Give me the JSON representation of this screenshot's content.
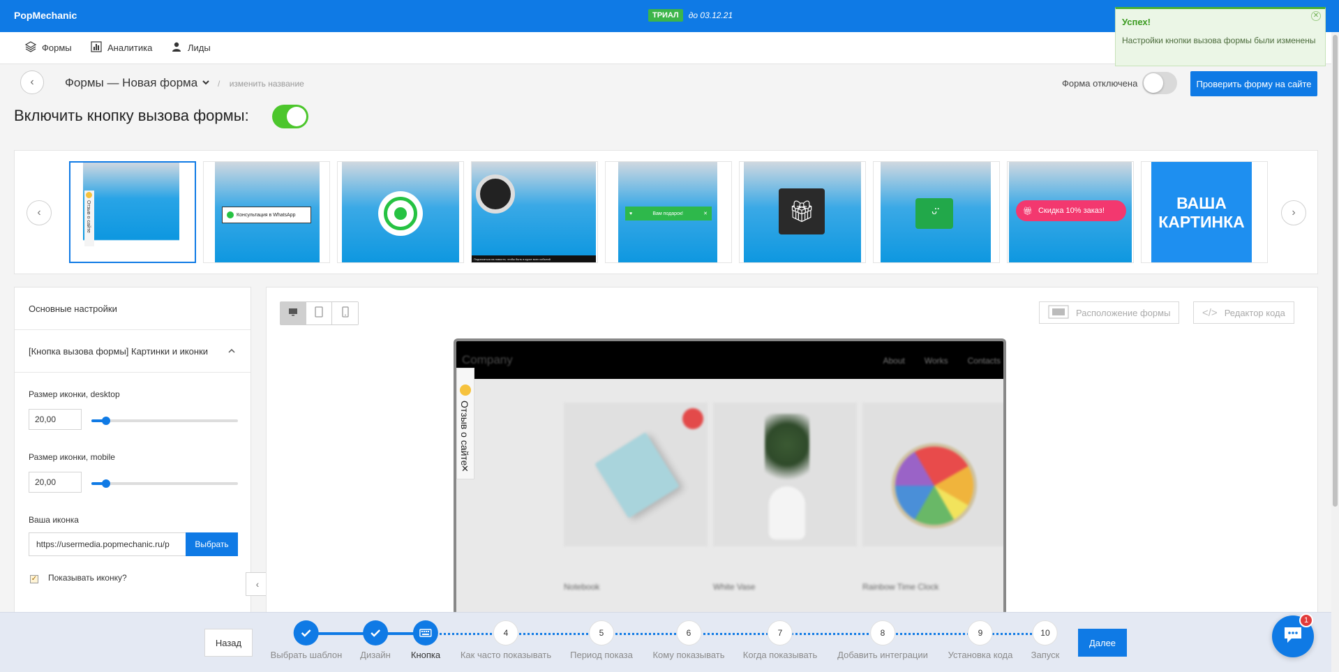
{
  "app": {
    "brand": "PopMechanic",
    "trial_badge": "ТРИАЛ",
    "trial_until": "до 03.12.21"
  },
  "nav": {
    "items": [
      {
        "label": "Формы",
        "icon": "layers-icon"
      },
      {
        "label": "Аналитика",
        "icon": "bar-chart-icon"
      },
      {
        "label": "Лиды",
        "icon": "user-icon"
      }
    ]
  },
  "header": {
    "form_title": "Формы — Новая форма",
    "rename_link": "изменить название",
    "separator": "/",
    "status_label": "Форма отключена",
    "status_enabled": false,
    "check_button": "Проверить форму на сайте"
  },
  "call_button": {
    "title": "Включить кнопку вызова формы:",
    "enabled": true
  },
  "templates": {
    "selected_index": 0,
    "items": [
      {
        "name": "side-tab-review",
        "caption": "Отзыв о сайте"
      },
      {
        "name": "whatsapp-consult",
        "caption": "Консультация в WhatsApp"
      },
      {
        "name": "whatsapp-icon",
        "caption": ""
      },
      {
        "name": "camera-banner",
        "caption": "Подписаться на новости, чтобы быть в курсе всех событий"
      },
      {
        "name": "gift-bar",
        "caption": "Вам подарок!"
      },
      {
        "name": "gift-icon",
        "caption": ""
      },
      {
        "name": "chat-smile-icon",
        "caption": ""
      },
      {
        "name": "discount-pill",
        "caption": "Скидка 10% заказ!"
      },
      {
        "name": "your-picture",
        "caption": "ВАША КАРТИНКА"
      }
    ]
  },
  "settings": {
    "main_section": "Основные настройки",
    "section_title": "[Кнопка вызова формы] Картинки и иконки",
    "icon_size_desktop_label": "Размер иконки, desktop",
    "icon_size_desktop_value": "20,00",
    "icon_size_desktop_fraction": 0.1,
    "icon_size_mobile_label": "Размер иконки, mobile",
    "icon_size_mobile_value": "20,00",
    "icon_size_mobile_fraction": 0.1,
    "your_icon_label": "Ваша иконка",
    "your_icon_value": "https://usermedia.popmechanic.ru/p",
    "choose_button": "Выбрать",
    "show_icon_label": "Показывать иконку?",
    "show_icon_checked": true
  },
  "preview": {
    "devices": [
      {
        "name": "desktop",
        "active": true
      },
      {
        "name": "tablet",
        "active": false
      },
      {
        "name": "mobile",
        "active": false
      }
    ],
    "position_button": "Расположение формы",
    "code_button": "Редактор кода",
    "site": {
      "brand": "Company",
      "nav": [
        "About",
        "Works",
        "Contacts"
      ],
      "products": [
        "Notebook",
        "White Vase",
        "Rainbow Time Clock"
      ]
    },
    "side_tab_text": "Отзыв о сайте",
    "side_tab_close": "✕"
  },
  "wizard": {
    "back": "Назад",
    "next": "Далее",
    "steps": [
      {
        "num": "1",
        "label": "Выбрать шаблон",
        "state": "done"
      },
      {
        "num": "2",
        "label": "Дизайн",
        "state": "done"
      },
      {
        "num": "3",
        "label": "Кнопка",
        "state": "current"
      },
      {
        "num": "4",
        "label": "Как часто показывать",
        "state": "todo"
      },
      {
        "num": "5",
        "label": "Период показа",
        "state": "todo"
      },
      {
        "num": "6",
        "label": "Кому показывать",
        "state": "todo"
      },
      {
        "num": "7",
        "label": "Когда показывать",
        "state": "todo"
      },
      {
        "num": "8",
        "label": "Добавить интеграции",
        "state": "todo"
      },
      {
        "num": "9",
        "label": "Установка кода",
        "state": "todo"
      },
      {
        "num": "10",
        "label": "Запуск",
        "state": "todo"
      }
    ]
  },
  "chat": {
    "badge": "1"
  },
  "toast": {
    "title": "Успех!",
    "message": "Настройки кнопки вызова формы были изменены",
    "close": "✕"
  },
  "colors": {
    "primary": "#0f7ae5",
    "success": "#4cc62c",
    "toast_bg": "#ebf6e6"
  }
}
